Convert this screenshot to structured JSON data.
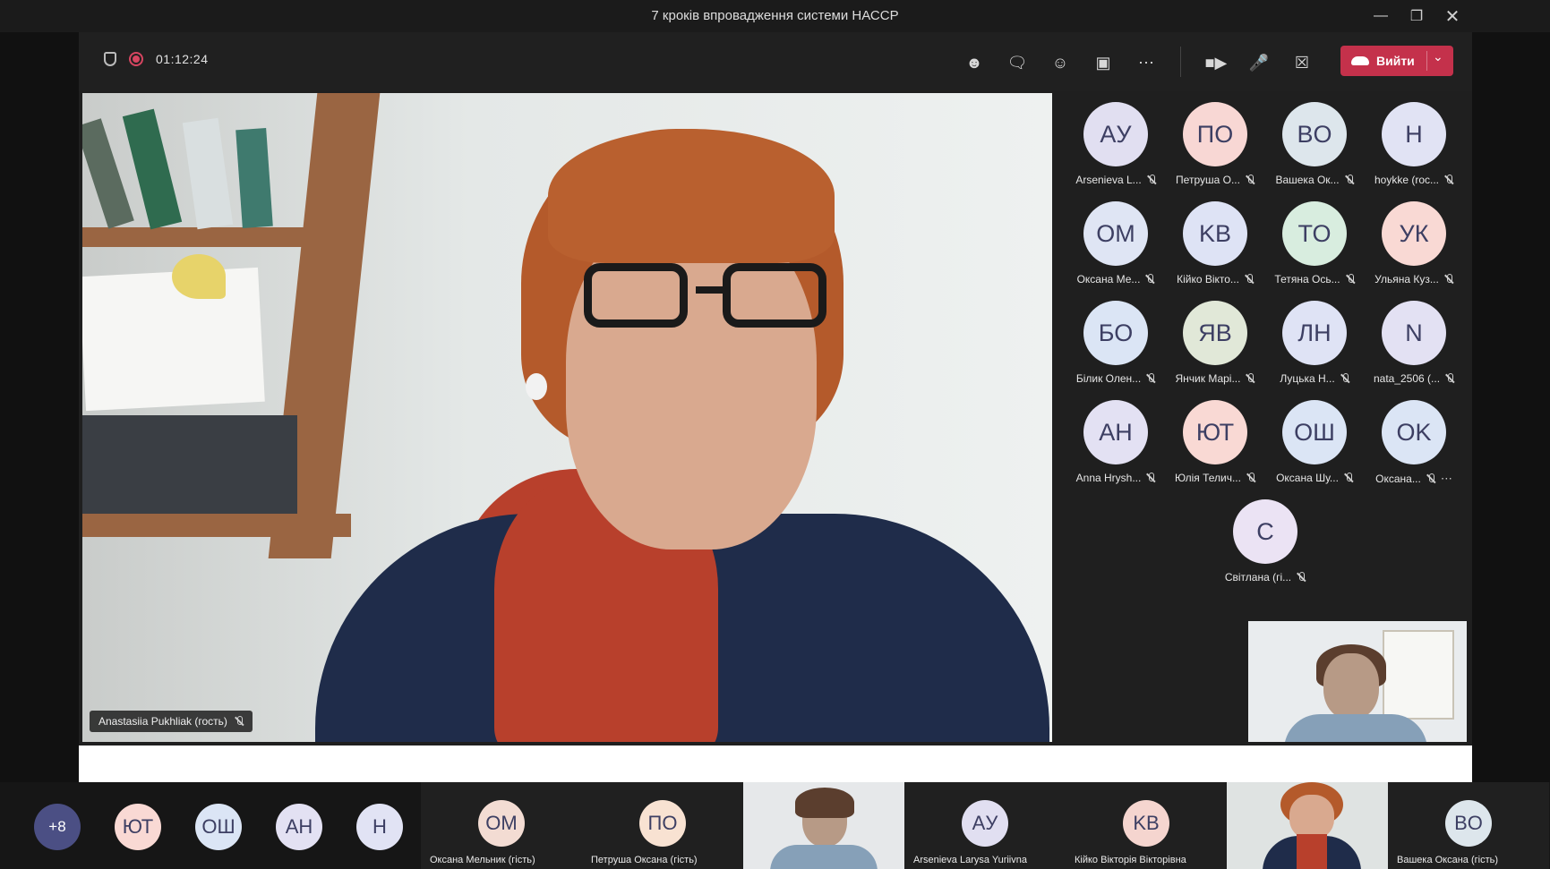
{
  "window": {
    "title": "7 кроків впровадження системи НАССР",
    "minimize_icon": "minimize-icon",
    "restore_icon": "restore-icon",
    "close_icon": "close-icon"
  },
  "toolbar": {
    "timer": "01:12:24",
    "icons": [
      "people-icon",
      "chat-icon",
      "reactions-icon",
      "view-icon",
      "more-icon",
      "camera-icon",
      "mic-icon",
      "share-icon"
    ],
    "leave_label": "Вийти",
    "leave_color": "#c4314b"
  },
  "main_video": {
    "speaker_name": "Anastasiia Pukhliak (гость)"
  },
  "participants": [
    {
      "initials": "AУ",
      "name": "Arsenieva L...",
      "color": "#e1dff1"
    },
    {
      "initials": "ПО",
      "name": "Петруша О...",
      "color": "#f8d7d4"
    },
    {
      "initials": "BO",
      "name": "Вашека Ок...",
      "color": "#dde6ec"
    },
    {
      "initials": "H",
      "name": "hoykke (roc...",
      "color": "#e1e3f4"
    },
    {
      "initials": "OM",
      "name": "Оксана Ме...",
      "color": "#dfe5f4"
    },
    {
      "initials": "KB",
      "name": "Кійко Вікто...",
      "color": "#dee3f5"
    },
    {
      "initials": "TO",
      "name": "Тетяна Ось...",
      "color": "#d8eddf"
    },
    {
      "initials": "УК",
      "name": "Ульяна Куз...",
      "color": "#f9d9d4"
    },
    {
      "initials": "БО",
      "name": "Білик Олен...",
      "color": "#dbe5f5"
    },
    {
      "initials": "ЯВ",
      "name": "Янчик Марі...",
      "color": "#e1e8d8"
    },
    {
      "initials": "ЛН",
      "name": "Луцька Н...",
      "color": "#dfe3f5"
    },
    {
      "initials": "N",
      "name": "nata_2506 (...",
      "color": "#e3e1f3"
    },
    {
      "initials": "AH",
      "name": "Anna Hrysh...",
      "color": "#e3e1f3"
    },
    {
      "initials": "ЮТ",
      "name": "Юлія Телич...",
      "color": "#f9d9d4"
    },
    {
      "initials": "ОШ",
      "name": "Оксана Шу...",
      "color": "#dbe5f5"
    },
    {
      "initials": "OK",
      "name": "Оксана...",
      "color": "#dbe5f5"
    },
    {
      "initials": "C",
      "name": "Світлана (гі...",
      "color": "#ebe3f4"
    }
  ],
  "filmstrip": {
    "overflow_label": "+8",
    "mini_avatars": [
      {
        "initials": "ЮТ",
        "color": "#f9d9d4"
      },
      {
        "initials": "ОШ",
        "color": "#dbe5f5"
      },
      {
        "initials": "AH",
        "color": "#e3e1f3"
      },
      {
        "initials": "H",
        "color": "#e1e3f4"
      }
    ],
    "tiles": [
      {
        "initials": "OM",
        "name": "Оксана Мельник (гість)",
        "color": "#f3dcd3"
      },
      {
        "initials": "ПО",
        "name": "Петруша Оксана (гість)",
        "color": "#f8e2d2"
      },
      {
        "initials": "AУ",
        "name": "Arsenieva Larysa Yuriivna",
        "color": "#e1dff1"
      },
      {
        "initials": "KB",
        "name": "Кійко Вікторія Вікторівна",
        "color": "#f5d5cf"
      },
      {
        "initials": "BO",
        "name": "Вашека Оксана (гість)",
        "color": "#dde6ec"
      }
    ]
  }
}
